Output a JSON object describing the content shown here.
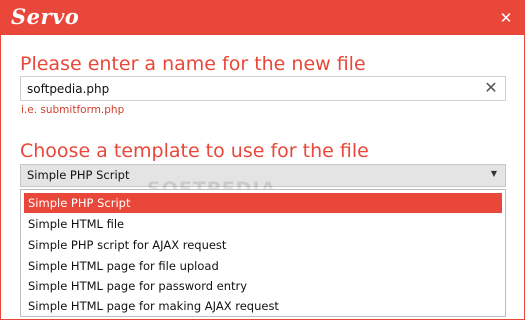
{
  "titlebar": {
    "app_name": "Servo",
    "close_icon": "close-icon"
  },
  "form": {
    "name_label": "Please enter a name for the new file",
    "name_value": "softpedia.php",
    "clear_icon": "clear-icon",
    "name_hint": "i.e. submitform.php",
    "template_label": "Choose a template to use for the file",
    "template_selected": "Simple PHP Script",
    "chevron_icon": "chevron-down-icon"
  },
  "dropdown": {
    "items": [
      "Simple PHP Script",
      "Simple HTML file",
      "Simple PHP script for AJAX request",
      "Simple HTML page for file upload",
      "Simple HTML page for password entry",
      "Simple HTML page for making AJAX request"
    ],
    "highlighted_index": 0
  },
  "watermark": "SOFTPEDIA",
  "colors": {
    "accent": "#e8473a"
  }
}
